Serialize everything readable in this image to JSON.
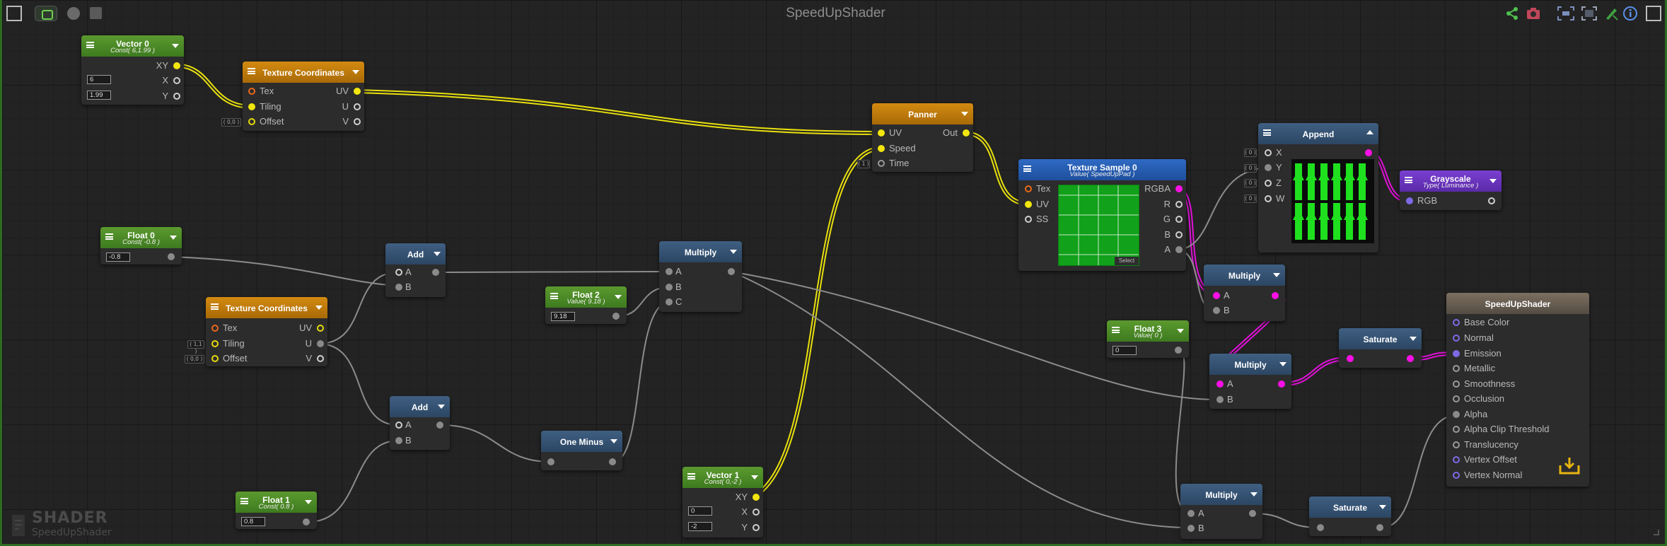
{
  "window": {
    "title": "SpeedUpShader"
  },
  "watermark": {
    "line1": "SHADER",
    "line2": "SpeedUpShader"
  },
  "colors": {
    "uv_wire": "#e8e00e",
    "rgba_wire": "#e010d8",
    "float_wire": "#8c8c8c"
  },
  "nodes": {
    "vector0": {
      "title": "Vector 0",
      "subtitle": "Const( 6,1.99 )",
      "out": "XY",
      "x_label": "X",
      "y_label": "Y",
      "x_value": "6",
      "y_value": "1.99"
    },
    "texcoord0": {
      "title": "Texture Coordinates",
      "tex": "Tex",
      "tiling": "Tiling",
      "offset": "Offset",
      "offset_default": "( 0,0 )",
      "out_uv": "UV",
      "out_u": "U",
      "out_v": "V"
    },
    "panner": {
      "title": "Panner",
      "uv": "UV",
      "speed": "Speed",
      "time": "Time",
      "time_default": "( 1 )",
      "out": "Out"
    },
    "texsample0": {
      "title": "Texture Sample 0",
      "subtitle": "Value( SpeedUpPad )",
      "tex": "Tex",
      "uv": "UV",
      "ss": "SS",
      "rgba": "RGBA",
      "r": "R",
      "g": "G",
      "b": "B",
      "a": "A",
      "select": "Select"
    },
    "append": {
      "title": "Append",
      "x": "X",
      "y": "Y",
      "z": "Z",
      "w": "W",
      "default0": "( 0 )",
      "default1": "( 0 )",
      "default2": "( 0 )",
      "default3": "( 0 )"
    },
    "grayscale": {
      "title": "Grayscale",
      "subtitle": "Type( Luminance )",
      "in": "RGB"
    },
    "float0": {
      "title": "Float 0",
      "subtitle": "Const( -0.8 )",
      "value": "-0.8"
    },
    "texcoord1": {
      "title": "Texture Coordinates",
      "tex": "Tex",
      "tiling": "Tiling",
      "offset": "Offset",
      "tiling_default": "( 1,1 )",
      "offset_default": "( 0,0 )",
      "out_uv": "UV",
      "out_u": "U",
      "out_v": "V"
    },
    "add0": {
      "title": "Add",
      "a": "A",
      "b": "B"
    },
    "add1": {
      "title": "Add",
      "a": "A",
      "b": "B"
    },
    "float1": {
      "title": "Float 1",
      "subtitle": "Const( 0.8 )",
      "value": "0.8"
    },
    "float2": {
      "title": "Float 2",
      "subtitle": "Value( 9.18 )",
      "value": "9.18"
    },
    "multiply0": {
      "title": "Multiply",
      "a": "A",
      "b": "B",
      "c": "C"
    },
    "oneminus": {
      "title": "One Minus"
    },
    "vector1": {
      "title": "Vector 1",
      "subtitle": "Const( 0,-2 )",
      "out": "XY",
      "x_label": "X",
      "y_label": "Y",
      "x_value": "0",
      "y_value": "-2"
    },
    "multiply1": {
      "title": "Multiply",
      "a": "A",
      "b": "B"
    },
    "float3": {
      "title": "Float 3",
      "subtitle": "Value( 0 )",
      "value": "0"
    },
    "multiply2": {
      "title": "Multiply",
      "a": "A",
      "b": "B"
    },
    "saturate0": {
      "title": "Saturate"
    },
    "multiply3": {
      "title": "Multiply",
      "a": "A",
      "b": "B"
    },
    "saturate1": {
      "title": "Saturate"
    },
    "output": {
      "title": "SpeedUpShader",
      "ports": [
        "Base Color",
        "Normal",
        "Emission",
        "Metallic",
        "Smoothness",
        "Occlusion",
        "Alpha",
        "Alpha Clip Threshold",
        "Translucency",
        "Vertex Offset",
        "Vertex Normal"
      ]
    }
  },
  "toolbar": {
    "left_icons": [
      "maximize-icon",
      "preview-toggle-icon",
      "record-icon",
      "save-icon"
    ],
    "right_icons": [
      "share-icon",
      "camera-icon",
      "focus-icon",
      "frame-icon",
      "cleanup-icon",
      "info-icon",
      "maximize-icon"
    ]
  }
}
